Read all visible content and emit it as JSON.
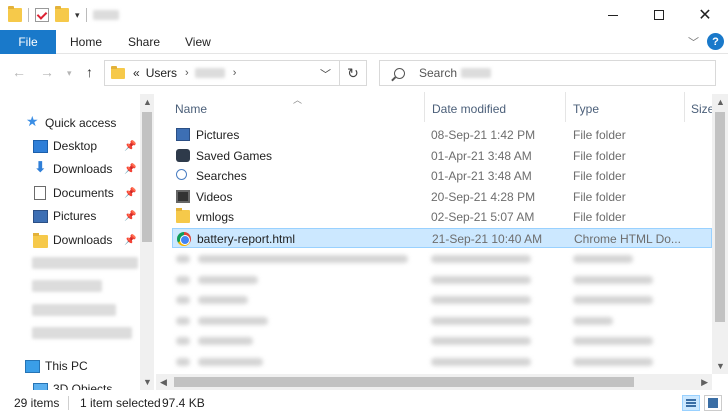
{
  "ribbon": {
    "file_tab": "File",
    "tabs": [
      "Home",
      "Share",
      "View"
    ]
  },
  "address": {
    "prefix": "«",
    "crumb": "Users",
    "search_placeholder": "Search"
  },
  "navpane": {
    "quick_access": "Quick access",
    "items": [
      {
        "label": "Desktop",
        "icon": "desktop-icon",
        "pinned": true
      },
      {
        "label": "Downloads",
        "icon": "download-icon",
        "pinned": true
      },
      {
        "label": "Documents",
        "icon": "documents-icon",
        "pinned": true
      },
      {
        "label": "Pictures",
        "icon": "pictures-icon",
        "pinned": true
      },
      {
        "label": "Downloads",
        "icon": "folder-icon",
        "pinned": true
      }
    ],
    "this_pc": "This PC",
    "objects_3d": "3D Objects"
  },
  "columns": {
    "name": "Name",
    "date": "Date modified",
    "type": "Type",
    "size": "Size"
  },
  "files": [
    {
      "name": "Pictures",
      "date": "08-Sep-21 1:42 PM",
      "type": "File folder",
      "icon": "pictures-folder-icon"
    },
    {
      "name": "Saved Games",
      "date": "01-Apr-21 3:48 AM",
      "type": "File folder",
      "icon": "saved-games-icon"
    },
    {
      "name": "Searches",
      "date": "01-Apr-21 3:48 AM",
      "type": "File folder",
      "icon": "searches-icon"
    },
    {
      "name": "Videos",
      "date": "20-Sep-21 4:28 PM",
      "type": "File folder",
      "icon": "videos-icon"
    },
    {
      "name": "vmlogs",
      "date": "02-Sep-21 5:07 AM",
      "type": "File folder",
      "icon": "folder-icon"
    },
    {
      "name": "battery-report.html",
      "date": "21-Sep-21 10:40 AM",
      "type": "Chrome HTML Do...",
      "icon": "chrome-icon",
      "selected": true
    }
  ],
  "status": {
    "count": "29 items",
    "selection": "1 item selected",
    "size": "97.4 KB"
  },
  "colors": {
    "accent": "#1979ca",
    "selection": "#cce8ff",
    "selection_border": "#99d1ff"
  }
}
